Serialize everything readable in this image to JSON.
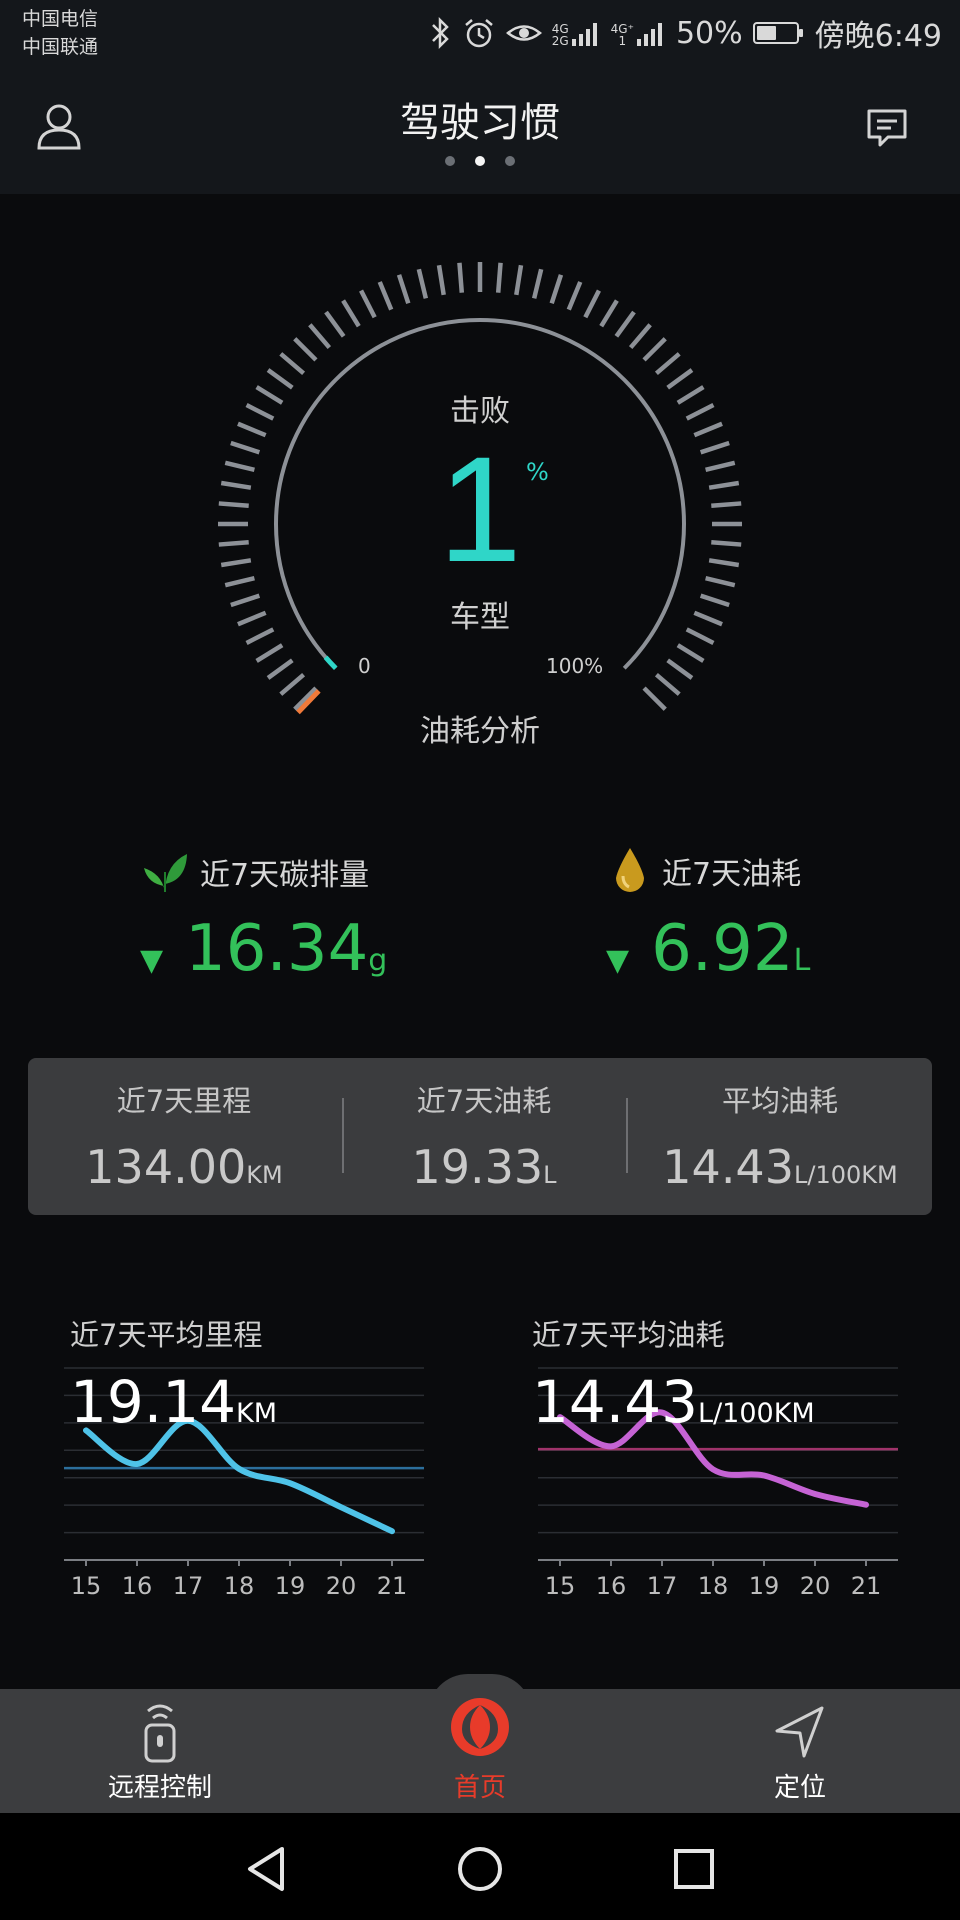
{
  "status_bar": {
    "carrier_1": "中国电信",
    "carrier_2": "中国联通",
    "net_1_top": "4G",
    "net_1_bottom": "2G",
    "net_2_top": "4G⁺",
    "net_2_bottom": "1",
    "battery_percent": "50%",
    "battery_level": 0.5,
    "time": "傍晚6:49"
  },
  "header": {
    "title": "驾驶习惯",
    "page_count": 3,
    "active_page": 1
  },
  "gauge": {
    "top_label": "击败",
    "value": "1",
    "unit": "%",
    "bottom_label": "车型",
    "min_label": "0",
    "max_label": "100%",
    "caption": "油耗分析",
    "percent": 1,
    "accent_color": "#2fd6c8",
    "marker_color": "#f07a3a"
  },
  "stats": {
    "carbon": {
      "label": "近7天碳排量",
      "value": "16.34",
      "unit": "g",
      "trend": "▼",
      "icon": "leaf-icon"
    },
    "fuel": {
      "label": "近7天油耗",
      "value": "6.92",
      "unit": "L",
      "trend": "▼",
      "icon": "oil-drop-icon"
    },
    "color": "#33c15a"
  },
  "summary": {
    "mileage": {
      "label": "近7天里程",
      "value": "134.00",
      "unit": "KM"
    },
    "fuel": {
      "label": "近7天油耗",
      "value": "19.33",
      "unit": "L"
    },
    "avg": {
      "label": "平均油耗",
      "value": "14.43",
      "unit": "L/100KM"
    }
  },
  "charts": {
    "mileage": {
      "title": "近7天平均里程",
      "value": "19.14",
      "unit": "KM",
      "color": "#4fc3e8",
      "avg_line_color": "#2c6f9c"
    },
    "fuel": {
      "title": "近7天平均油耗",
      "value": "14.43",
      "unit": "L/100KM",
      "color": "#c563d4",
      "avg_line_color": "#a0336a"
    }
  },
  "chart_data": [
    {
      "type": "line",
      "categories": [
        "15",
        "16",
        "17",
        "18",
        "19",
        "20",
        "21"
      ],
      "series": [
        {
          "values": [
            27,
            20,
            29,
            19,
            16,
            11,
            6
          ]
        }
      ],
      "reference_line": 19.14,
      "ylim": [
        0,
        40
      ],
      "grid": true
    },
    {
      "type": "line",
      "categories": [
        "15",
        "16",
        "17",
        "18",
        "19",
        "20",
        "21"
      ],
      "series": [
        {
          "values": [
            18.6,
            14.8,
            19.2,
            11.8,
            11.0,
            8.6,
            7.2
          ]
        }
      ],
      "reference_line": 14.43,
      "ylim": [
        0,
        25
      ],
      "grid": true
    }
  ],
  "bottom_nav": {
    "items": [
      {
        "label": "远程控制",
        "icon": "remote-control-icon"
      },
      {
        "label": "首页",
        "icon": "dongfeng-logo-icon"
      },
      {
        "label": "定位",
        "icon": "navigation-arrow-icon"
      }
    ],
    "active_index": 1,
    "active_color": "#e83b2a"
  },
  "system_nav": {
    "icons": [
      "back-icon",
      "home-icon",
      "recents-icon"
    ]
  }
}
